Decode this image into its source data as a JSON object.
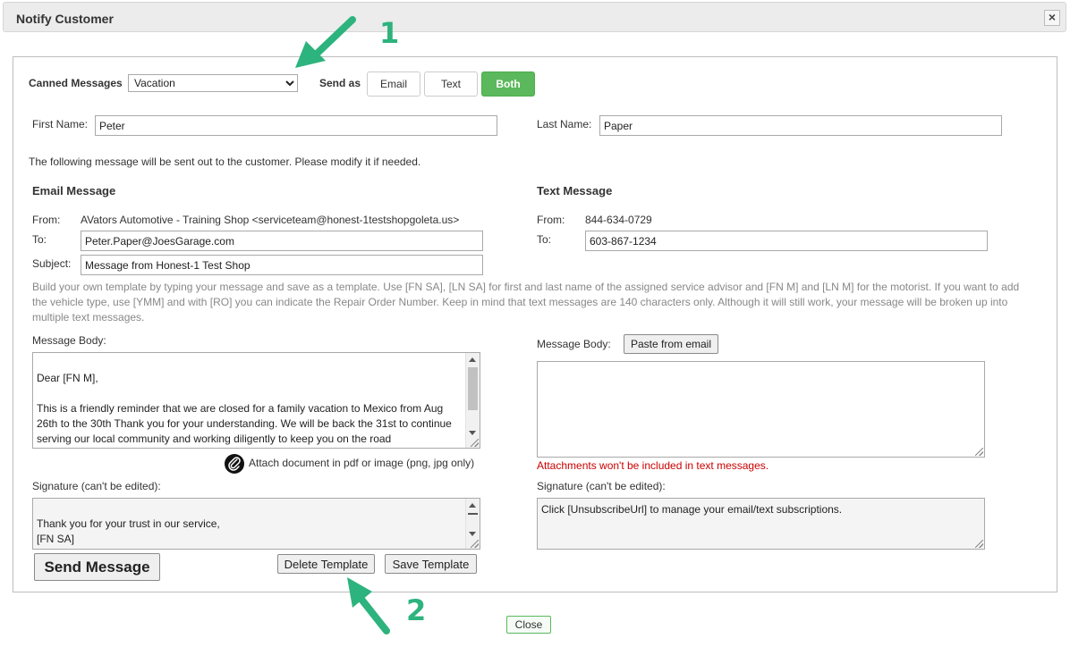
{
  "dialog": {
    "title": "Notify Customer",
    "close_label": "Close"
  },
  "canned": {
    "label": "Canned Messages",
    "selected": "Vacation"
  },
  "send_as": {
    "label": "Send as",
    "email": "Email",
    "text": "Text",
    "both": "Both",
    "active_color": "#5cb85c"
  },
  "customer": {
    "first_name_label": "First Name:",
    "first_name": "Peter",
    "last_name_label": "Last Name:",
    "last_name": "Paper"
  },
  "intro": "The following message will be sent out to the customer. Please modify it if needed.",
  "email": {
    "heading": "Email Message",
    "from_label": "From:",
    "from_value": "AVators Automotive - Training Shop <serviceteam@honest-1testshopgoleta.us>",
    "to_label": "To:",
    "to_value": "Peter.Paper@JoesGarage.com",
    "subject_label": "Subject:",
    "subject_value": "Message from Honest-1 Test Shop",
    "body_label": "Message Body:",
    "body_line1": "Dear [FN M],",
    "body_line2": "This is a friendly reminder that we are closed for a family vacation to Mexico from Aug",
    "body_line3": "26th to the 30th Thank you for your understanding. We will be back the 31st to continue",
    "body_line4": "serving our local community and working diligently to keep you on the road",
    "attach_label": "Attach document in pdf or image (png, jpg only)",
    "signature_label": "Signature (can't be edited):",
    "signature_line1": "Thank you for your trust in our service,",
    "signature_line2": "[FN SA]"
  },
  "help_text": {
    "line1": "Build your own template by typing your message and save as a template. Use [FN SA], [LN SA] for first and last name of the assigned service advisor and [FN M] and [LN M] for the motorist. If you want to add",
    "line2": "the vehicle type, use [YMM] and with [RO] you can indicate the Repair Order Number. Keep in mind that text messages are 140 characters only. Although it will still work, your message will be broken up into",
    "line3": "multiple text messages."
  },
  "text": {
    "heading": "Text Message",
    "from_label": "From:",
    "from_value": "844-634-0729",
    "to_label": "To:",
    "to_value": "603-867-1234",
    "body_label": "Message Body:",
    "paste_label": "Paste from email",
    "attach_warning": "Attachments won't be included in text messages.",
    "signature_label": "Signature (can't be edited):",
    "signature_value": "Click [UnsubscribeUrl] to manage your email/text subscriptions."
  },
  "actions": {
    "send": "Send Message",
    "delete_template": "Delete Template",
    "save_template": "Save Template"
  },
  "annotations": {
    "marker1": "1",
    "marker2": "2",
    "arrow_color": "#2db37d"
  }
}
